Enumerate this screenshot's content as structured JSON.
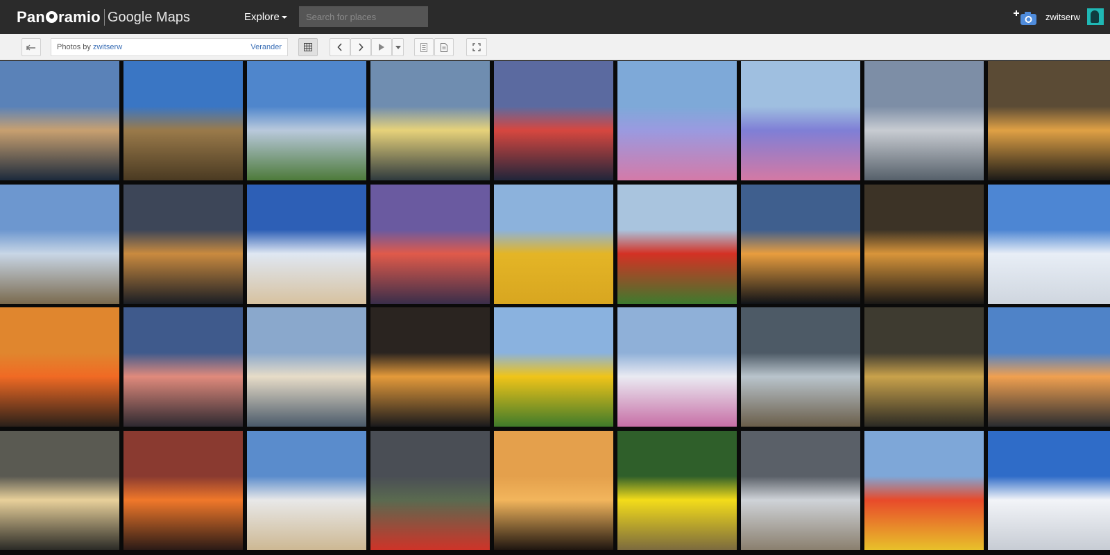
{
  "header": {
    "logo_part1": "Pan",
    "logo_part2": "ramio",
    "maps_label": "Google Maps",
    "explore_label": "Explore",
    "search_placeholder": "Search for places",
    "username": "zwitserw"
  },
  "toolbar": {
    "photos_by_prefix": "Photos by ",
    "photos_by_user": "zwitserw",
    "change_label": "Verander"
  },
  "photos": [
    {
      "sky": "#5a82b8",
      "mid": "#c8a070",
      "ground": "#1c2a3c"
    },
    {
      "sky": "#3a76c4",
      "mid": "#9a7a4a",
      "ground": "#4a3a22"
    },
    {
      "sky": "#4f86cc",
      "mid": "#b9c9dc",
      "ground": "#4d7a3a"
    },
    {
      "sky": "#6f8db0",
      "mid": "#e7d27a",
      "ground": "#2f3a3e"
    },
    {
      "sky": "#5b6aa0",
      "mid": "#d7473f",
      "ground": "#20253a"
    },
    {
      "sky": "#7ea9d8",
      "mid": "#9a9ae0",
      "ground": "#d47aa8"
    },
    {
      "sky": "#9fbfe0",
      "mid": "#7f7fd6",
      "ground": "#d479a4"
    },
    {
      "sky": "#7d8ea6",
      "mid": "#c8ccd2",
      "ground": "#56606a"
    },
    {
      "sky": "#5b4b35",
      "mid": "#e0a145",
      "ground": "#1b1a17"
    },
    {
      "sky": "#6d97cf",
      "mid": "#c8d6e6",
      "ground": "#7a6a4e"
    },
    {
      "sky": "#3d4658",
      "mid": "#c98a3f",
      "ground": "#1b1e24"
    },
    {
      "sky": "#2d5fb6",
      "mid": "#dfe7f2",
      "ground": "#d7c2a0"
    },
    {
      "sky": "#6a5aa0",
      "mid": "#e05a4a",
      "ground": "#3a2e4a"
    },
    {
      "sky": "#8cb2dc",
      "mid": "#e4b526",
      "ground": "#d8a620"
    },
    {
      "sky": "#a9c4de",
      "mid": "#d43124",
      "ground": "#3e7a2e"
    },
    {
      "sky": "#3f5f8e",
      "mid": "#e89d3e",
      "ground": "#101318"
    },
    {
      "sky": "#3c3326",
      "mid": "#d8953a",
      "ground": "#1a1816"
    },
    {
      "sky": "#4d86d3",
      "mid": "#e8eef6",
      "ground": "#cfd6df"
    },
    {
      "sky": "#e0862e",
      "mid": "#f06a24",
      "ground": "#2a2019"
    },
    {
      "sky": "#3f5a8c",
      "mid": "#e08a7c",
      "ground": "#2e2930"
    },
    {
      "sky": "#8aa8cc",
      "mid": "#e7dcc8",
      "ground": "#4a5a6a"
    },
    {
      "sky": "#2a2420",
      "mid": "#e49a3a",
      "ground": "#1a1a1c"
    },
    {
      "sky": "#8ab2df",
      "mid": "#f0c419",
      "ground": "#3f7a2a"
    },
    {
      "sky": "#8fb0d8",
      "mid": "#eaeaf2",
      "ground": "#c76fa6"
    },
    {
      "sky": "#4d5a66",
      "mid": "#b9c4cc",
      "ground": "#6a5e4a"
    },
    {
      "sky": "#3e3b30",
      "mid": "#c9a24b",
      "ground": "#2b2a24"
    },
    {
      "sky": "#4f83c8",
      "mid": "#f0a050",
      "ground": "#2a2c30"
    },
    {
      "sky": "#5a5a52",
      "mid": "#e8d09a",
      "ground": "#2a2a26"
    },
    {
      "sky": "#8a3a30",
      "mid": "#f0782a",
      "ground": "#2a1a16"
    },
    {
      "sky": "#5a8ccc",
      "mid": "#e8e8e8",
      "ground": "#cdb893"
    },
    {
      "sky": "#4a4e55",
      "mid": "#5a6a50",
      "ground": "#cf3328"
    },
    {
      "sky": "#e4a04c",
      "mid": "#f2b55c",
      "ground": "#1e1510"
    },
    {
      "sky": "#2f5f2a",
      "mid": "#f3dc1a",
      "ground": "#7b6a3e"
    },
    {
      "sky": "#5a6068",
      "mid": "#cfd3d8",
      "ground": "#8a7f6e"
    },
    {
      "sky": "#7ea7d8",
      "mid": "#e84a2a",
      "ground": "#e8c12a"
    },
    {
      "sky": "#2f6cc8",
      "mid": "#f2f4f8",
      "ground": "#c7ccd4"
    }
  ]
}
